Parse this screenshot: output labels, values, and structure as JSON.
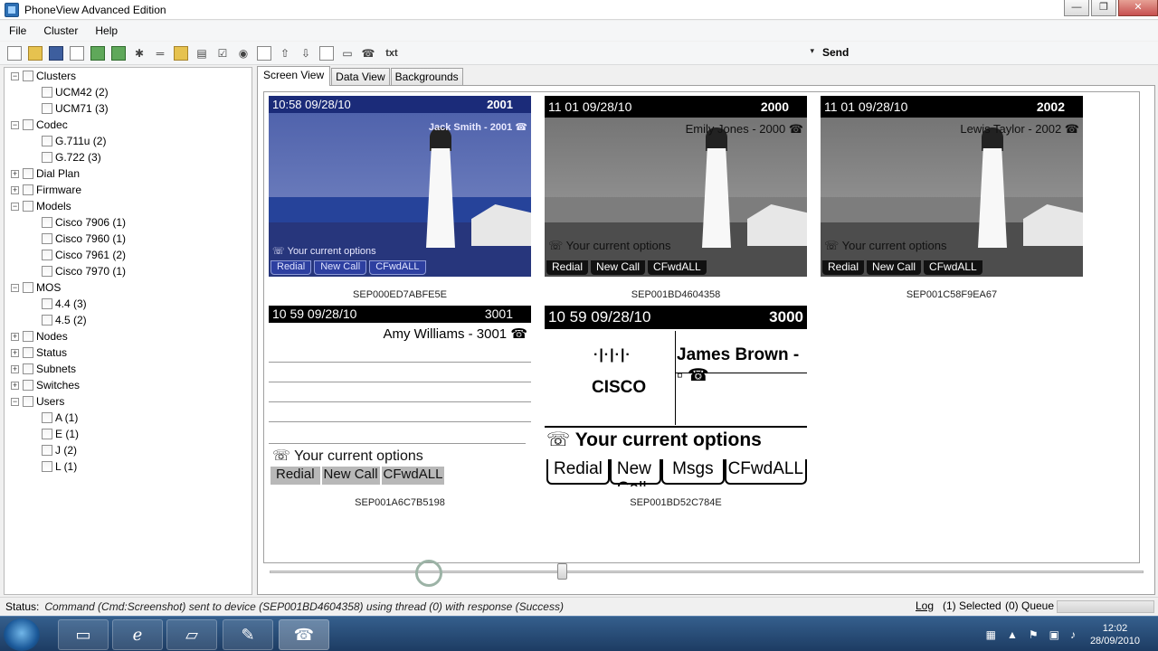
{
  "window": {
    "title": "PhoneView Advanced Edition",
    "min": "—",
    "max": "❐",
    "close": "✕"
  },
  "menu": [
    "File",
    "Cluster",
    "Help"
  ],
  "toolbar": {
    "txt": "txt",
    "send": "Send",
    "combo_arrow": "▾"
  },
  "tree": [
    {
      "label": "Clusters",
      "level": 0,
      "expanded": true
    },
    {
      "label": "UCM42 (2)",
      "level": 1
    },
    {
      "label": "UCM71 (3)",
      "level": 1
    },
    {
      "label": "Codec",
      "level": 0,
      "expanded": true
    },
    {
      "label": "G.711u (2)",
      "level": 1
    },
    {
      "label": "G.722 (3)",
      "level": 1
    },
    {
      "label": "Dial Plan",
      "level": 0,
      "expanded": false
    },
    {
      "label": "Firmware",
      "level": 0,
      "expanded": false
    },
    {
      "label": "Models",
      "level": 0,
      "expanded": true
    },
    {
      "label": "Cisco 7906 (1)",
      "level": 1
    },
    {
      "label": "Cisco 7960 (1)",
      "level": 1
    },
    {
      "label": "Cisco 7961 (2)",
      "level": 1
    },
    {
      "label": "Cisco 7970 (1)",
      "level": 1
    },
    {
      "label": "MOS",
      "level": 0,
      "expanded": true
    },
    {
      "label": "4.4 (3)",
      "level": 1
    },
    {
      "label": "4.5 (2)",
      "level": 1
    },
    {
      "label": "Nodes",
      "level": 0,
      "expanded": false
    },
    {
      "label": "Status",
      "level": 0,
      "expanded": false
    },
    {
      "label": "Subnets",
      "level": 0,
      "expanded": false
    },
    {
      "label": "Switches",
      "level": 0,
      "expanded": false
    },
    {
      "label": "Users",
      "level": 0,
      "expanded": true
    },
    {
      "label": "A (1)",
      "level": 1
    },
    {
      "label": "E (1)",
      "level": 1
    },
    {
      "label": "J (2)",
      "level": 1
    },
    {
      "label": "L (1)",
      "level": 1
    }
  ],
  "tabs": [
    "Screen View",
    "Data View",
    "Backgrounds"
  ],
  "phones": [
    {
      "device": "SEP000ED7ABFE5E",
      "time": "10:58 09/28/10",
      "ext": "2001",
      "line": "Jack Smith - 2001 ☎",
      "options": "☏ Your current options",
      "keys": [
        "Redial",
        "New Call",
        "CFwdALL"
      ]
    },
    {
      "device": "SEP001BD4604358",
      "time": "11 01 09/28/10",
      "ext": "2000",
      "line": "Emily Jones - 2000 ☎",
      "options": "☏ Your current options",
      "keys": [
        "Redial",
        "New Call",
        "CFwdALL"
      ]
    },
    {
      "device": "SEP001C58F9EA67",
      "time": "11 01 09/28/10",
      "ext": "2002",
      "line": "Lewis Taylor - 2002 ☎",
      "options": "☏ Your current options",
      "keys": [
        "Redial",
        "New Call",
        "CFwdALL"
      ]
    },
    {
      "device": "SEP001A6C7B5198",
      "time": "10 59 09/28/10",
      "ext": "3001",
      "line": "Amy Williams - 3001 ☎",
      "options": "☏ Your current options",
      "keys": [
        "Redial",
        "New Call",
        "CFwdALL"
      ]
    },
    {
      "device": "SEP001BD52C784E",
      "time": "10 59 09/28/10",
      "ext": "3000",
      "line": "James Brown - ▫ ☎",
      "options": "☏ Your current options",
      "keys": [
        "Redial",
        "New Call",
        "Msgs",
        "CFwdALL"
      ],
      "logo_text": "CISCO",
      "logo_bars": "·|·|·|·"
    }
  ],
  "status": {
    "label": "Status:",
    "message": "Command (Cmd:Screenshot) sent to device (SEP001BD4604358) using thread (0) with response (Success)",
    "log": "Log",
    "selected": "(1) Selected",
    "queue": "(0) Queue"
  },
  "taskbar": {
    "time": "12:02",
    "date": "28/09/2010"
  },
  "colors": {
    "accent": "#1b2b79",
    "selection": "#3399ff"
  }
}
